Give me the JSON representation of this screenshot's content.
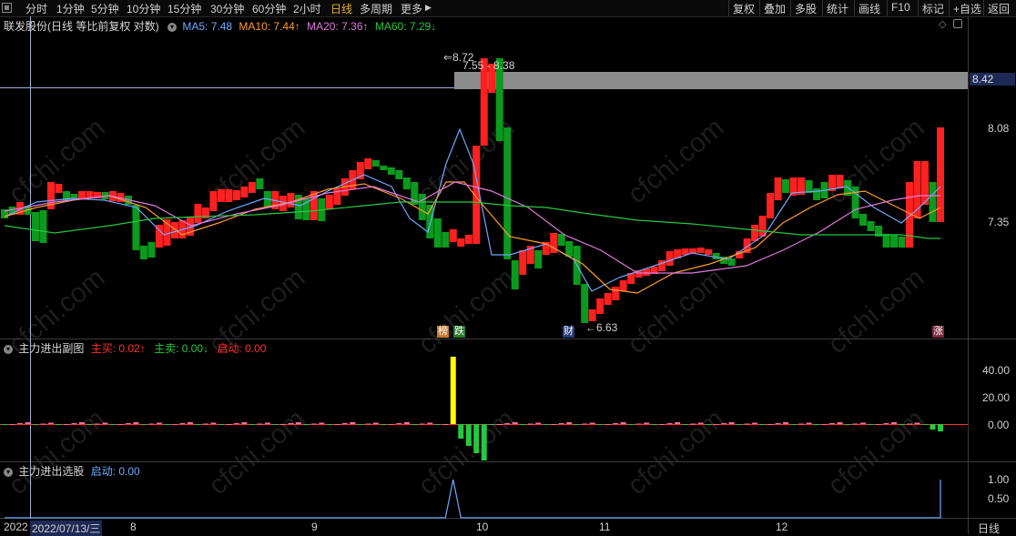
{
  "toolbar": {
    "left": [
      "分时",
      "1分钟",
      "5分钟",
      "10分钟",
      "15分钟",
      "30分钟",
      "60分钟",
      "2小时",
      "日线",
      "多周期",
      "更多"
    ],
    "active": "日线",
    "more_arrow": "▶",
    "right": [
      "复权",
      "叠加",
      "多股",
      "统计",
      "画线",
      "F10",
      "标记",
      "+自选",
      "返回"
    ]
  },
  "header": {
    "stock": "联发股份(日线 等比前复权 对数)",
    "ma5": "MA5: 7.48",
    "ma10": "MA10: 7.44↑",
    "ma20": "MA20: 7.36↑",
    "ma60": "MA60: 7.29↓"
  },
  "price_axis": [
    "8.42",
    "8.08",
    "7.35"
  ],
  "annotations": {
    "high": "8.72",
    "range": "7.55 - 8.38",
    "low": "6.63",
    "tag_bang": "榜",
    "tag_die": "跌",
    "tag_cai": "财",
    "tag_zhang": "涨"
  },
  "sub1": {
    "title": "主力进出副图",
    "main_buy": "主买: 0.02↑",
    "main_sell": "主卖: 0.00↓",
    "start": "启动: 0.00",
    "axis": [
      "40.00",
      "20.00",
      "0.00"
    ]
  },
  "sub2": {
    "title": "主力进出选股",
    "start": "启动: 0.00",
    "axis": [
      "1.00",
      "0.50"
    ]
  },
  "xaxis": {
    "year": "2022",
    "date": "2022/07/13/三",
    "months": [
      "8",
      "9",
      "10",
      "11",
      "12"
    ],
    "period": "日线"
  },
  "watermark": "cfchi.com",
  "colors": {
    "up": "#ff2020",
    "down": "#0a9a1e",
    "ma5": "#6fa8ff",
    "ma10": "#ff9a30",
    "ma20": "#e07adf",
    "ma60": "#27c840"
  },
  "chart_data": {
    "type": "candlestick",
    "price_axis_ticks": [
      8.42,
      8.08,
      7.35
    ],
    "high": 8.72,
    "low": 6.63,
    "ma": {
      "MA5": 7.48,
      "MA10": 7.44,
      "MA20": 7.36,
      "MA60": 7.29
    },
    "sub1_axis": [
      0,
      20,
      40
    ],
    "sub2_axis": [
      0.5,
      1.0
    ]
  }
}
